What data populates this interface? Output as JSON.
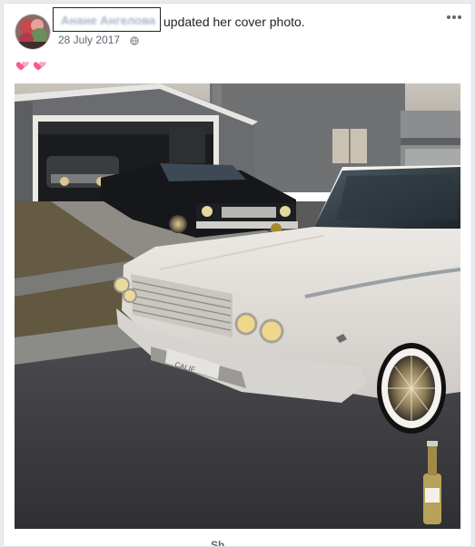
{
  "post": {
    "author_name": "Анане Ангелова",
    "action": "updated her cover photo.",
    "date": "28 July 2017",
    "separator": "·",
    "privacy_icon": "globe-icon",
    "more_icon": "more-options-icon",
    "caption_emoji": "two-hearts-emoji",
    "photo_subject": "cover-photo",
    "share_label": "Sh"
  },
  "colors": {
    "name_text": "#aab3c8",
    "body_text": "#1d2129",
    "meta_text": "#616770",
    "heart_pink": "#f25c8c"
  }
}
